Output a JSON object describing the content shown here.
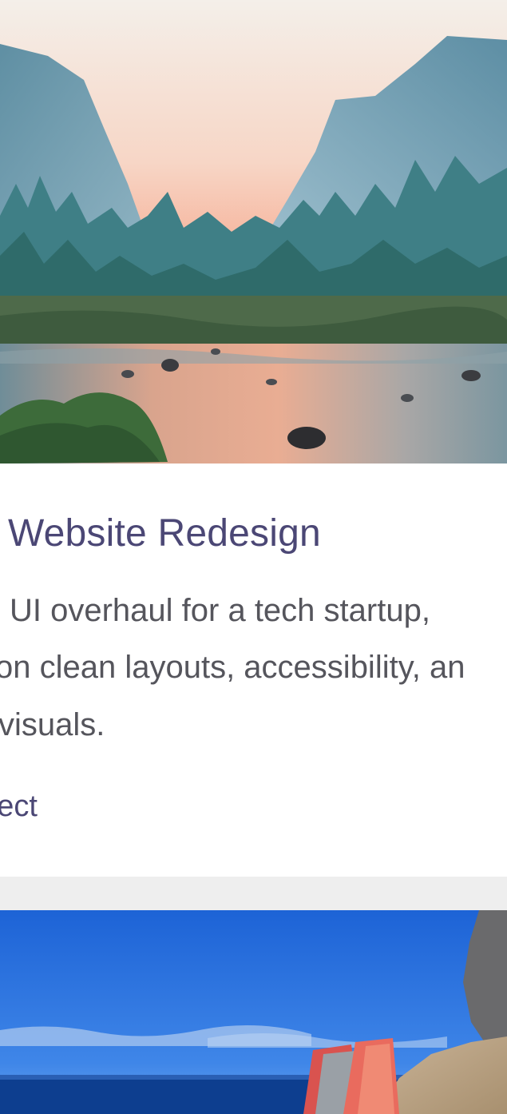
{
  "card1": {
    "title": "Website Redesign",
    "description_lines": [
      "UI overhaul for a tech startup,",
      "on clean layouts, accessibility, an",
      "visuals."
    ],
    "link_label": "ect",
    "image_name": "mountain-valley-river-photo"
  },
  "card2": {
    "image_name": "coastal-sea-rocks-photo"
  },
  "colors": {
    "title": "#4b4775",
    "body_text": "#55555c",
    "divider": "#eeeeee"
  }
}
